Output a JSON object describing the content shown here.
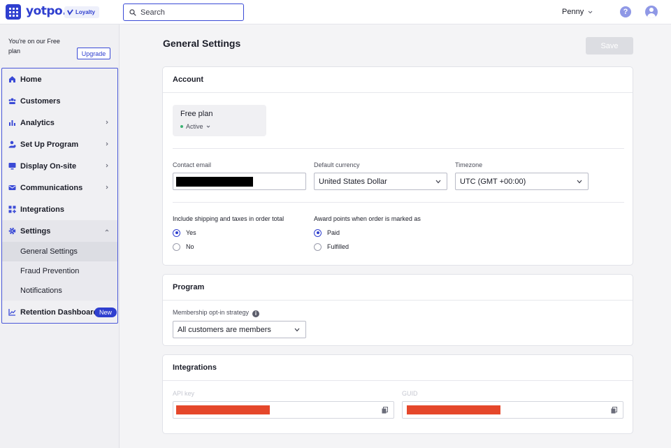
{
  "topbar": {
    "logo": "yotpo.",
    "product_badge": "Loyalty",
    "search_placeholder": "Search",
    "user_name": "Penny",
    "help_label": "?"
  },
  "sidebar": {
    "plan_text": "You're on our Free plan",
    "upgrade_label": "Upgrade",
    "items": [
      {
        "label": "Home",
        "icon": "home-icon"
      },
      {
        "label": "Customers",
        "icon": "customers-icon"
      },
      {
        "label": "Analytics",
        "icon": "analytics-icon"
      },
      {
        "label": "Set Up Program",
        "icon": "setup-icon"
      },
      {
        "label": "Display On-site",
        "icon": "display-icon"
      },
      {
        "label": "Communications",
        "icon": "mail-icon"
      },
      {
        "label": "Integrations",
        "icon": "integrations-icon"
      },
      {
        "label": "Settings",
        "icon": "gear-icon"
      }
    ],
    "settings_sub": [
      {
        "label": "General Settings",
        "selected": true
      },
      {
        "label": "Fraud Prevention"
      },
      {
        "label": "Notifications"
      }
    ],
    "retention": {
      "label": "Retention Dashboard",
      "badge": "New"
    }
  },
  "main": {
    "title": "General Settings",
    "save_label": "Save",
    "account": {
      "heading": "Account",
      "plan_name": "Free plan",
      "plan_status": "Active",
      "contact_email_label": "Contact email",
      "currency_label": "Default currency",
      "currency_value": "United States Dollar",
      "timezone_label": "Timezone",
      "timezone_value": "UTC (GMT +00:00)",
      "shipping_label": "Include shipping and taxes in order total",
      "shipping_options": [
        "Yes",
        "No"
      ],
      "award_label": "Award points when order is marked as",
      "award_options": [
        "Paid",
        "Fulfilled"
      ]
    },
    "program": {
      "heading": "Program",
      "optin_label": "Membership opt-in strategy",
      "optin_value": "All customers are members"
    },
    "integrations": {
      "heading": "Integrations",
      "api_key_label": "API key",
      "guid_label": "GUID"
    }
  },
  "colors": {
    "accent": "#2f3fcf",
    "redaction": "#e5472b",
    "active_dot": "#3bb273"
  }
}
